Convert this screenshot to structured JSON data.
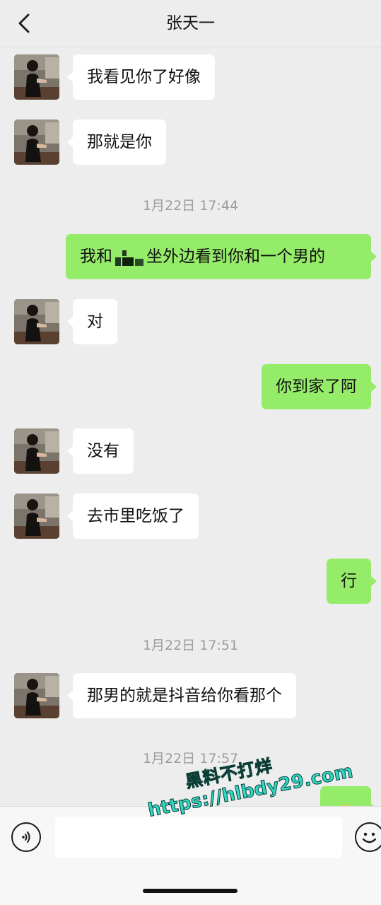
{
  "header": {
    "title": "张天一"
  },
  "messages": [
    {
      "text": "我看见你了好像"
    },
    {
      "text": "那就是你"
    },
    {
      "timestamp": "1月22日 17:44"
    },
    {
      "text_pre": "我和",
      "text_post": "坐外边看到你和一个男的"
    },
    {
      "text": "对"
    },
    {
      "text": "你到家了阿"
    },
    {
      "text": "没有"
    },
    {
      "text": "去市里吃饭了"
    },
    {
      "text": "行"
    },
    {
      "timestamp": "1月22日 17:51"
    },
    {
      "text": "那男的就是抖音给你看那个"
    },
    {
      "timestamp": "1月22日 17:57"
    }
  ],
  "input": {
    "placeholder": ""
  },
  "watermark": {
    "line1": "黑料不打烊",
    "line2": "https://hlbdy29.com"
  },
  "colors": {
    "outgoing_bubble": "#95ec69",
    "incoming_bubble": "#ffffff",
    "background": "#ededed"
  }
}
